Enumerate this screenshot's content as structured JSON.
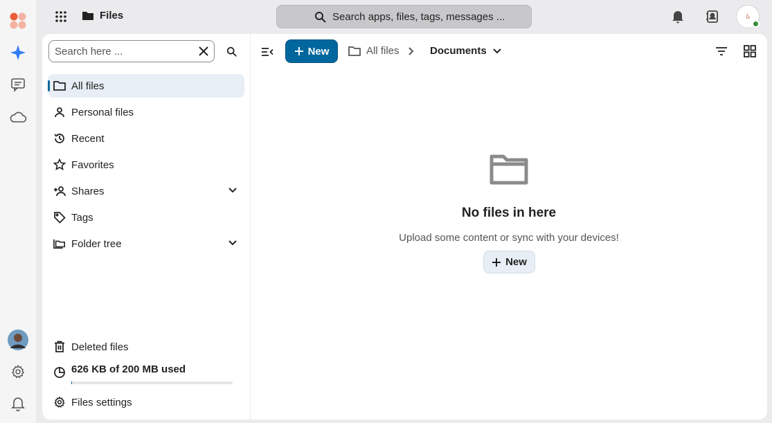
{
  "app": {
    "title": "Files"
  },
  "global_search": {
    "placeholder": "Search apps, files, tags, messages ..."
  },
  "user": {
    "initials": "ઠ"
  },
  "sidebar": {
    "search_placeholder": "Search here ...",
    "items": [
      {
        "label": "All files"
      },
      {
        "label": "Personal files"
      },
      {
        "label": "Recent"
      },
      {
        "label": "Favorites"
      },
      {
        "label": "Shares"
      },
      {
        "label": "Tags"
      },
      {
        "label": "Folder tree"
      }
    ],
    "deleted_label": "Deleted files",
    "quota_label": "626 KB of 200 MB used",
    "quota_fraction": 0.003,
    "settings_label": "Files settings"
  },
  "toolbar": {
    "new_label": "New",
    "breadcrumbs": [
      "All files",
      "Documents"
    ]
  },
  "empty_state": {
    "title": "No files in here",
    "subtitle": "Upload some content or sync with your devices!",
    "new_label": "New"
  },
  "colors": {
    "accent": "#00679e",
    "active_bg": "#e8eef5"
  }
}
